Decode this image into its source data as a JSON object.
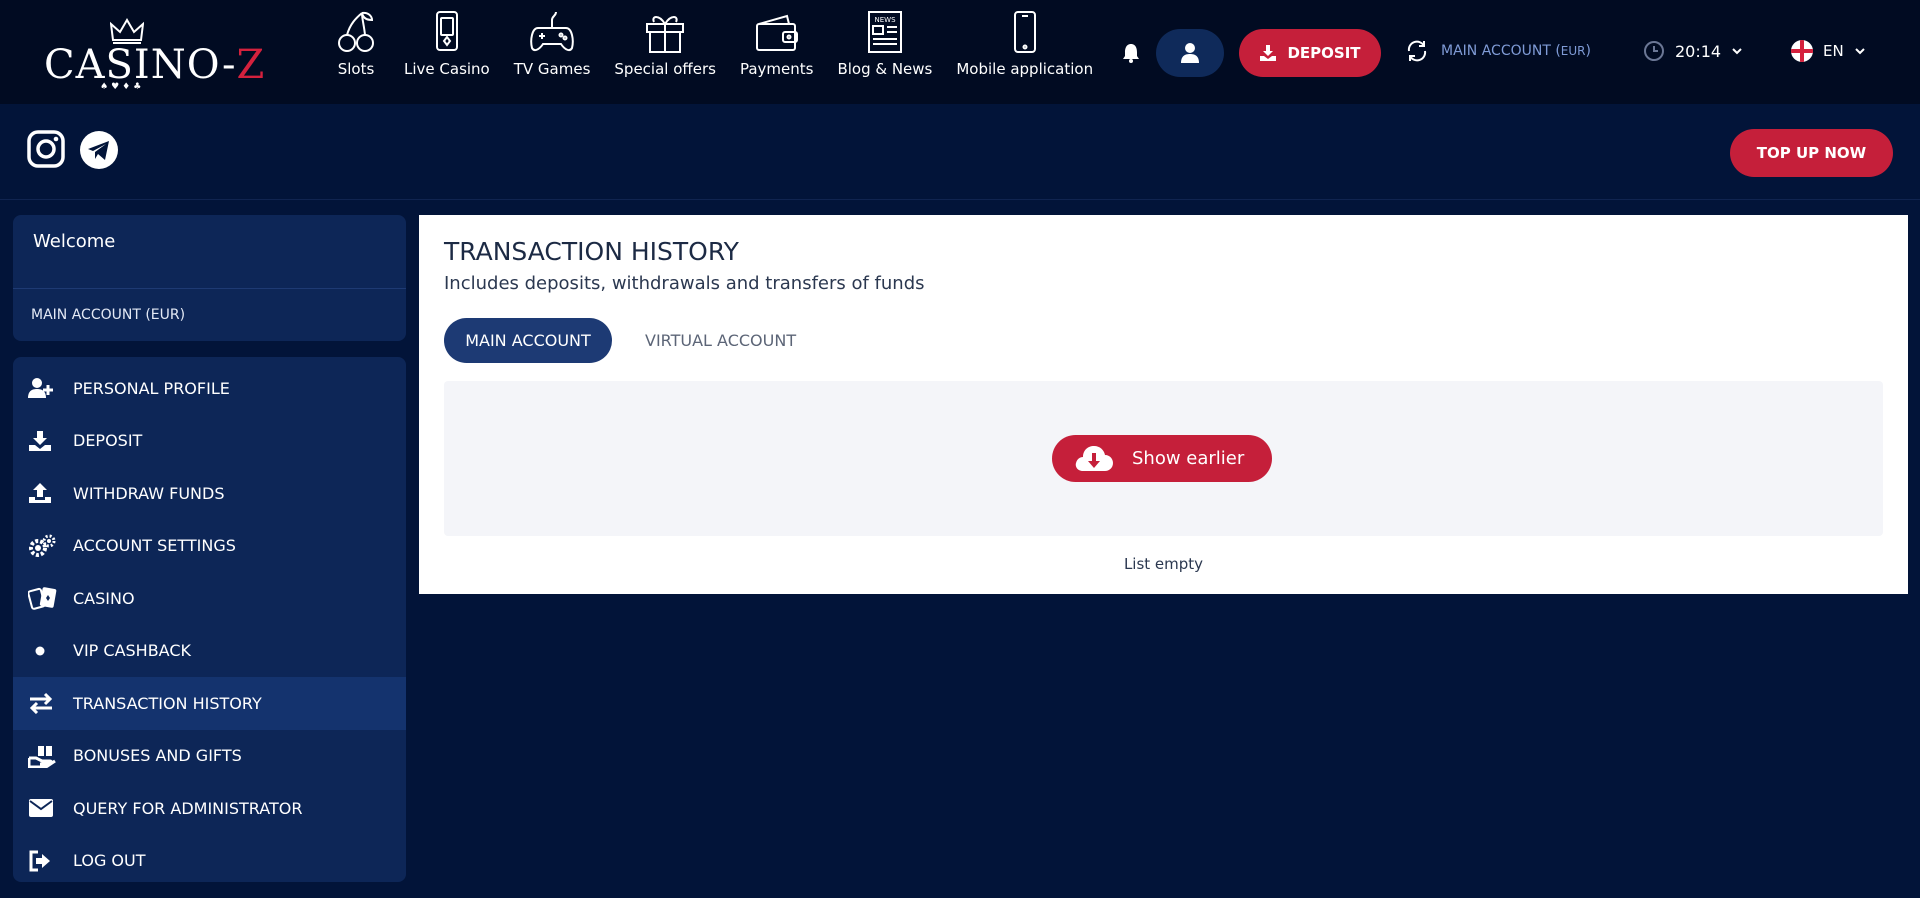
{
  "header": {
    "logo": {
      "text_main": "CASINO-",
      "text_accent": "Z",
      "suits": "♠♥♦♣"
    },
    "nav": [
      {
        "label": "Slots",
        "icon": "cherry-icon"
      },
      {
        "label": "Live Casino",
        "icon": "cards-phone-icon"
      },
      {
        "label": "TV Games",
        "icon": "gamepad-icon"
      },
      {
        "label": "Special offers",
        "icon": "gift-icon"
      },
      {
        "label": "Payments",
        "icon": "wallet-icon"
      },
      {
        "label": "Blog & News",
        "icon": "newspaper-icon"
      },
      {
        "label": "Mobile application",
        "icon": "smartphone-icon"
      }
    ],
    "deposit_label": "DEPOSIT",
    "account_label": "MAIN ACCOUNT (",
    "account_currency": "EUR",
    "account_close": ")",
    "time": "20:14",
    "language": "EN"
  },
  "social": {
    "topup_label": "TOP UP NOW"
  },
  "sidebar": {
    "welcome": "Welcome",
    "account": "MAIN ACCOUNT (EUR)",
    "items": [
      {
        "label": "PERSONAL PROFILE",
        "icon": "user-plus-icon"
      },
      {
        "label": "DEPOSIT",
        "icon": "download-tray-icon"
      },
      {
        "label": "WITHDRAW FUNDS",
        "icon": "upload-tray-icon"
      },
      {
        "label": "ACCOUNT SETTINGS",
        "icon": "gears-icon"
      },
      {
        "label": "CASINO",
        "icon": "playing-cards-icon"
      },
      {
        "label": "VIP CASHBACK",
        "icon": "dot-icon"
      },
      {
        "label": "TRANSACTION HISTORY",
        "icon": "exchange-arrows-icon",
        "active": true
      },
      {
        "label": "BONUSES AND GIFTS",
        "icon": "hand-gift-icon"
      },
      {
        "label": "QUERY FOR ADMINISTRATOR",
        "icon": "envelope-icon"
      },
      {
        "label": "LOG OUT",
        "icon": "sign-out-icon"
      }
    ]
  },
  "main": {
    "title": "TRANSACTION HISTORY",
    "subtitle": "Includes deposits, withdrawals and transfers of funds",
    "tabs": [
      {
        "label": "MAIN ACCOUNT",
        "active": true
      },
      {
        "label": "VIRTUAL ACCOUNT",
        "active": false
      }
    ],
    "show_earlier": "Show earlier",
    "empty_text": "List empty"
  },
  "colors": {
    "accent_red": "#c51f3a",
    "navy_bg": "#021439",
    "header_bg": "#010b22",
    "card_bg": "#0d2657"
  }
}
